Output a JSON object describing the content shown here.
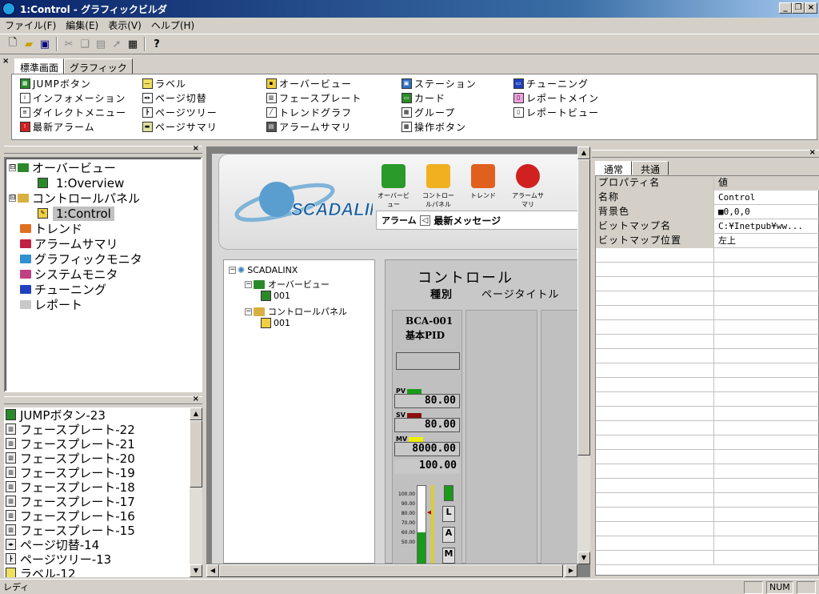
{
  "window": {
    "title": "1:Control - グラフィックビルダ",
    "controls": [
      "_",
      "8",
      "×"
    ]
  },
  "menu": [
    "ファイル(F)",
    "編集(E)",
    "表示(V)",
    "ヘルプ(H)"
  ],
  "toolbar": {
    "icons": [
      "new-file-icon",
      "open-folder-icon",
      "save-icon",
      "cut-icon",
      "copy-icon",
      "paste-icon",
      "pointer-icon",
      "properties-icon",
      "help-icon"
    ]
  },
  "palette": {
    "tabs": [
      "標準画面",
      "グラフィック"
    ],
    "columns": [
      [
        "JUMPボタン",
        "インフォメーション",
        "ダイレクトメニュー",
        "最新アラーム"
      ],
      [
        "ラベル",
        "ページ切替",
        "ページツリー",
        "ページサマリ"
      ],
      [
        "オーバービュー",
        "フェースプレート",
        "トレンドグラフ",
        "アラームサマリ"
      ],
      [
        "ステーション",
        "カード",
        "グループ",
        "操作ボタン"
      ],
      [
        "チューニング",
        "レポートメイン",
        "レポートビュー"
      ]
    ]
  },
  "tree": {
    "items": [
      {
        "label": "オーバービュー",
        "level": 0,
        "expander": "⊟",
        "color": "#2a8a2a"
      },
      {
        "label": "1:Overview",
        "level": 1,
        "kind": "page"
      },
      {
        "label": "コントロールパネル",
        "level": 0,
        "expander": "⊟",
        "color": "#d8b040"
      },
      {
        "label": "1:Control",
        "level": 1,
        "kind": "page-selected"
      },
      {
        "label": "トレンド",
        "level": 0,
        "color": "#e07020"
      },
      {
        "label": "アラームサマリ",
        "level": 0,
        "color": "#c02040"
      },
      {
        "label": "グラフィックモニタ",
        "level": 0,
        "color": "#3090d0"
      },
      {
        "label": "システムモニタ",
        "level": 0,
        "color": "#c04080"
      },
      {
        "label": "チューニング",
        "level": 0,
        "color": "#2040c0"
      },
      {
        "label": "レポート",
        "level": 0,
        "color": "#c8c8c8"
      }
    ]
  },
  "objects": [
    "JUMPボタン-23",
    "フェースプレート-22",
    "フェースプレート-21",
    "フェースプレート-20",
    "フェースプレート-19",
    "フェースプレート-18",
    "フェースプレート-17",
    "フェースプレート-16",
    "フェースプレート-15",
    "ページ切替-14",
    "ページツリー-13",
    "ラベル-12"
  ],
  "canvas": {
    "logo": "SCADALINX",
    "nav": [
      {
        "label": "オーバービュー",
        "color": "#2a9a2a"
      },
      {
        "label": "コントロールパネル",
        "color": "#f0b020"
      },
      {
        "label": "トレンド",
        "color": "#e06020"
      },
      {
        "label": "アラームサマリ",
        "color": "#d02020"
      }
    ],
    "alarm": {
      "label": "アラーム",
      "message": "最新メッセージ"
    },
    "navtree": {
      "root": "SCADALINX",
      "items": [
        {
          "label": "オーバービュー",
          "level": 1
        },
        {
          "label": "001",
          "level": 2
        },
        {
          "label": "コントロールパネル",
          "level": 1
        },
        {
          "label": "001",
          "level": 2
        }
      ]
    },
    "faceplate": {
      "title": "コントロール",
      "col_kind": "種別",
      "col_title": "ページタイトル",
      "tag": "BCA-001",
      "type": "基本PID",
      "pv_label": "PV",
      "pv": "80.00",
      "pv_color": "#1a9a1a",
      "sv_label": "SV",
      "sv": "80.00",
      "sv_color": "#8a1010",
      "mv_label": "MV",
      "mv": "8000.00",
      "mv_color": "#f0f000",
      "extra": "100.00",
      "scale": [
        "100.00",
        "90.00",
        "80.00",
        "70.00",
        "60.00",
        "50.00"
      ],
      "buttons": [
        "L",
        "A",
        "M"
      ]
    }
  },
  "properties": {
    "tabs": [
      "通常",
      "共通"
    ],
    "header": [
      "プロパティ名",
      "値"
    ],
    "rows": [
      {
        "name": "名称",
        "value": "Control"
      },
      {
        "name": "背景色",
        "value": "■0,0,0"
      },
      {
        "name": "ビットマップ名",
        "value": "C:¥Inetpub¥ww..."
      },
      {
        "name": "ビットマップ位置",
        "value": "左上"
      }
    ]
  },
  "status": {
    "text": "レディ",
    "num": "NUM"
  }
}
